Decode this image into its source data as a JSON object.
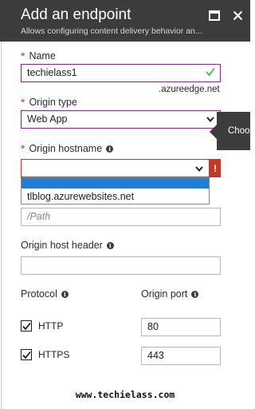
{
  "header": {
    "title": "Add an endpoint",
    "subtitle": "Allows configuring content delivery behavior an..."
  },
  "name": {
    "label": "Name",
    "value": "techielass1",
    "suffix": ".azureedge.net"
  },
  "origin_type": {
    "label": "Origin type",
    "value": "Web App"
  },
  "origin_hostname": {
    "label": "Origin hostname",
    "value": "",
    "error_glyph": "!",
    "tooltip": "Choo",
    "dropdown_option": "tlblog.azurewebsites.net"
  },
  "origin_path": {
    "placeholder": "/Path"
  },
  "origin_host_header": {
    "label": "Origin host header",
    "value": ""
  },
  "protocol": {
    "label": "Protocol",
    "http": "HTTP",
    "https": "HTTPS",
    "http_checked": true,
    "https_checked": true
  },
  "origin_port": {
    "label": "Origin port",
    "http_port": "80",
    "https_port": "443"
  },
  "footer": {
    "watermark": "www.techielass.com"
  },
  "colors": {
    "header_bg": "#3c3c3c",
    "valid_border": "#7a2f86",
    "error_red": "#c0392b",
    "valid_check": "#5cb85c",
    "dropdown_highlight": "#1e7fd8"
  }
}
